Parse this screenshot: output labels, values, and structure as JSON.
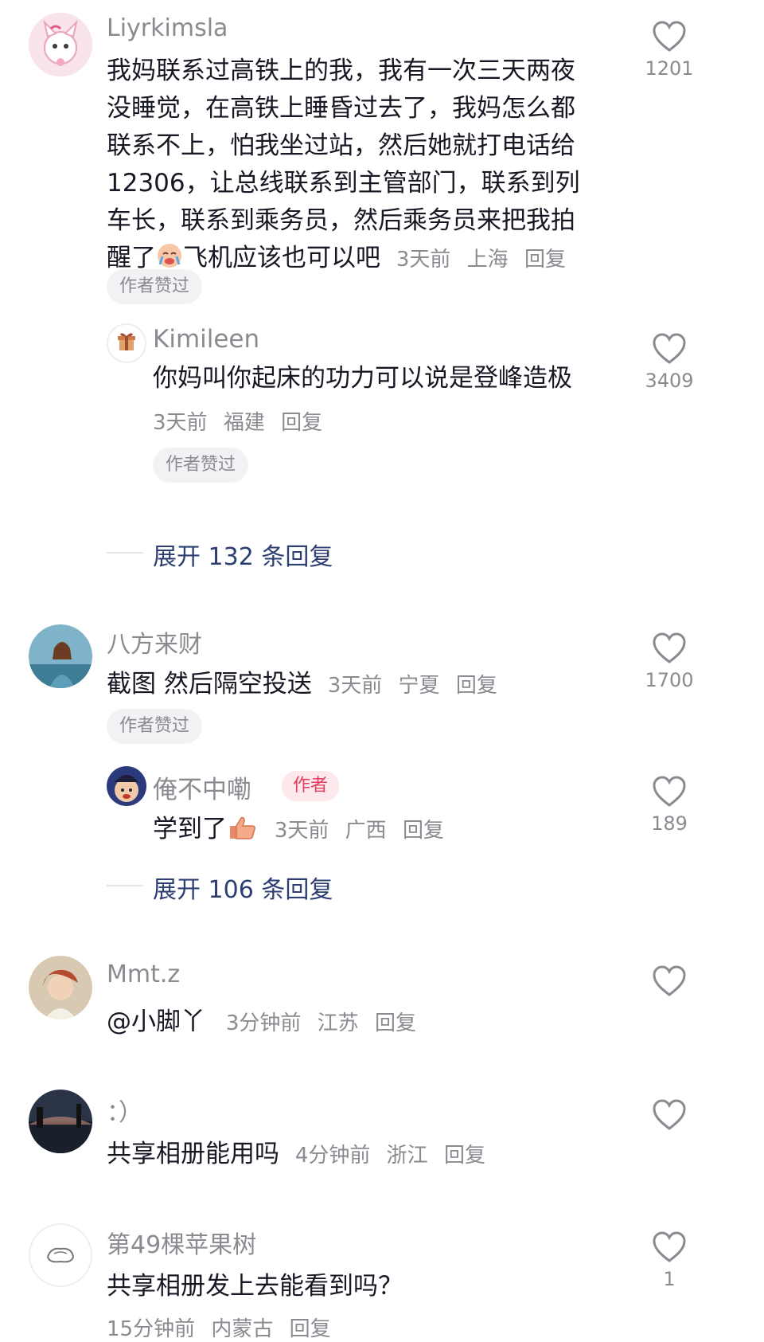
{
  "comments": [
    {
      "username": "Liyrkimsla",
      "lines": [
        "我妈联系过高铁上的我，我有一次三天两夜",
        "没睡觉，在高铁上睡昏过去了，我妈怎么都",
        "联系不上，怕我坐过站，然后她就打电话给",
        "12306，让总线联系到主管部门，联系到列",
        "车长，联系到乘务员，然后乘务员来把我拍"
      ],
      "last_line": "醒了",
      "last_line_tail": "飞机应该也可以吧",
      "time": "3天前",
      "location": "上海",
      "reply": "回复",
      "badge": "作者赞过",
      "likes": "1201"
    },
    {
      "username": "Kimileen",
      "text": "你妈叫你起床的功力可以说是登峰造极",
      "time": "3天前",
      "location": "福建",
      "reply": "回复",
      "badge": "作者赞过",
      "likes": "3409",
      "expand": "展开 132 条回复"
    },
    {
      "username": "八方来财",
      "text": "截图 然后隔空投送",
      "time": "3天前",
      "location": "宁夏",
      "reply": "回复",
      "badge": "作者赞过",
      "likes": "1700"
    },
    {
      "username": "俺不中嘞",
      "author_tag": "作者",
      "text": "学到了",
      "time": "3天前",
      "location": "广西",
      "reply": "回复",
      "likes": "189",
      "expand": "展开 106 条回复"
    },
    {
      "username": "Mmt.z",
      "text": "@小脚丫",
      "time": "3分钟前",
      "location": "江苏",
      "reply": "回复",
      "likes": ""
    },
    {
      "username": "：）",
      "text": "共享相册能用吗",
      "time": "4分钟前",
      "location": "浙江",
      "reply": "回复",
      "likes": ""
    },
    {
      "username": "第49棵苹果树",
      "text": "共享相册发上去能看到吗？",
      "time": "15分钟前",
      "location": "内蒙古",
      "reply": "回复",
      "likes": "1"
    }
  ],
  "icons": {
    "like": "heart-outline-icon"
  }
}
